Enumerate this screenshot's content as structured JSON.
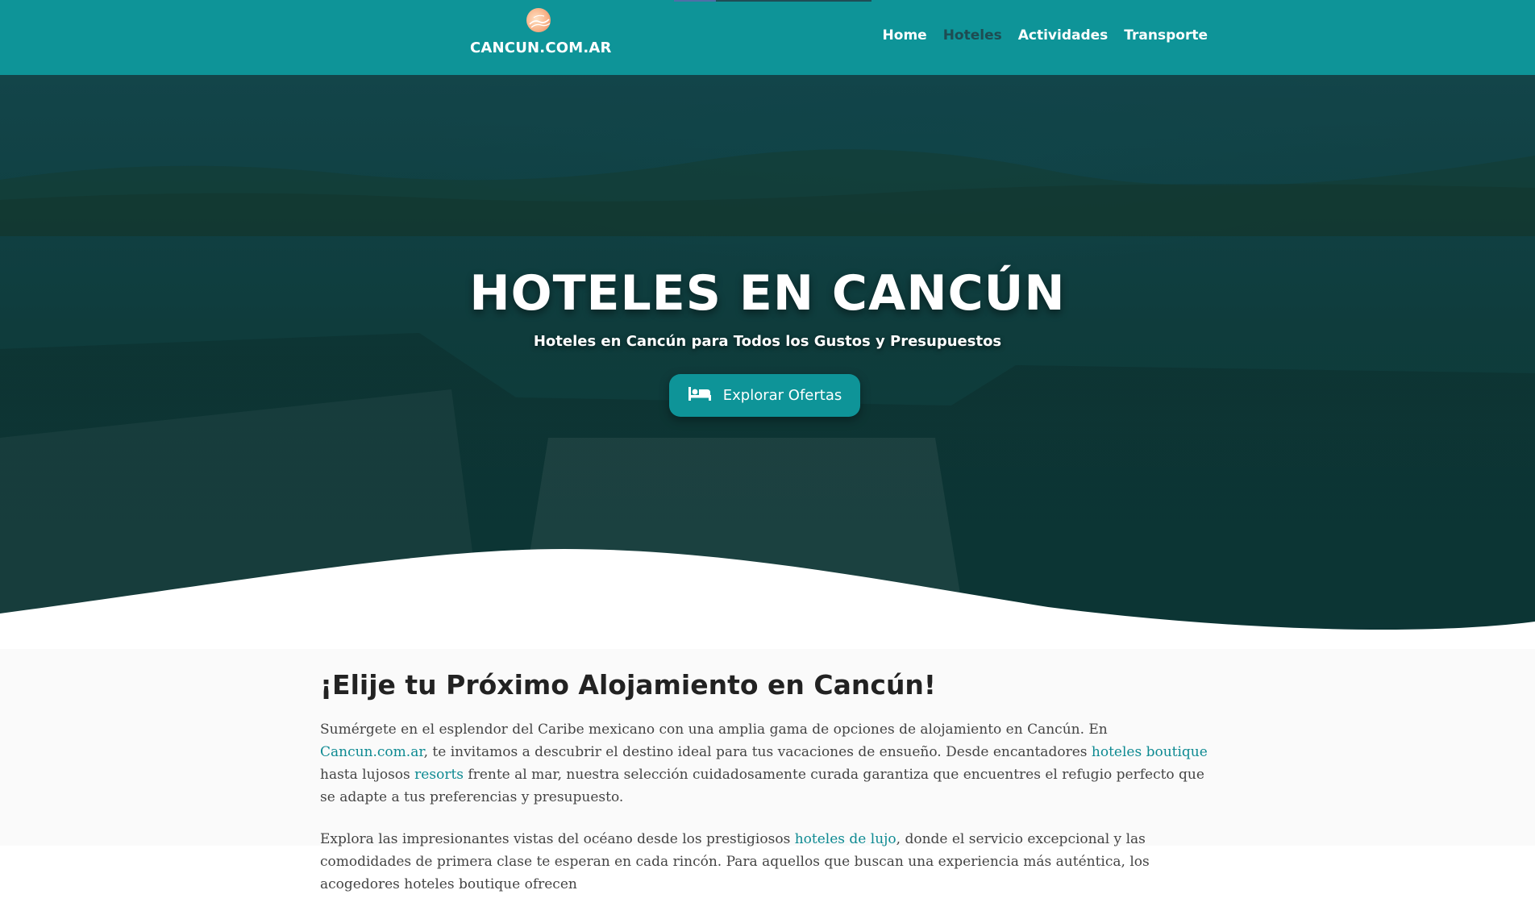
{
  "header": {
    "logo_text": "CANCUN.COM.AR",
    "nav": [
      {
        "label": "Home",
        "active": false
      },
      {
        "label": "Hoteles",
        "active": true
      },
      {
        "label": "Actividades",
        "active": false
      },
      {
        "label": "Transporte",
        "active": false
      }
    ]
  },
  "hero": {
    "title": "HOTELES EN CANCÚN",
    "subtitle": "Hoteles en Cancún para Todos los Gustos y Presupuestos",
    "button_label": "Explorar Ofertas",
    "button_icon": "bed-icon"
  },
  "content": {
    "heading": "¡Elije tu Próximo Alojamiento en Cancún!",
    "p1": {
      "t1": "Sumérgete en el esplendor del Caribe mexicano con una amplia gama de opciones de alojamiento en Cancún. En ",
      "link1": "Cancun.com.ar",
      "t2": ", te invitamos a descubrir el destino ideal para tus vacaciones de ensueño. Desde encantadores ",
      "link2": "hoteles boutique",
      "t3": " hasta lujosos ",
      "link3": "resorts",
      "t4": " frente al mar, nuestra selección cuidadosamente curada garantiza que encuentres el refugio perfecto que se adapte a tus preferencias y presupuesto."
    },
    "p2": {
      "t1": "Explora las impresionantes vistas del océano desde los prestigiosos ",
      "link1": "hoteles de lujo",
      "t2": ", donde el servicio excepcional y las comodidades de primera clase te esperan en cada rincón. Para aquellos que buscan una experiencia más auténtica, los acogedores hoteles boutique ofrecen"
    }
  },
  "colors": {
    "brand_teal": "#0e9498",
    "active_nav": "#1e4c52",
    "link": "#0e8a92"
  }
}
